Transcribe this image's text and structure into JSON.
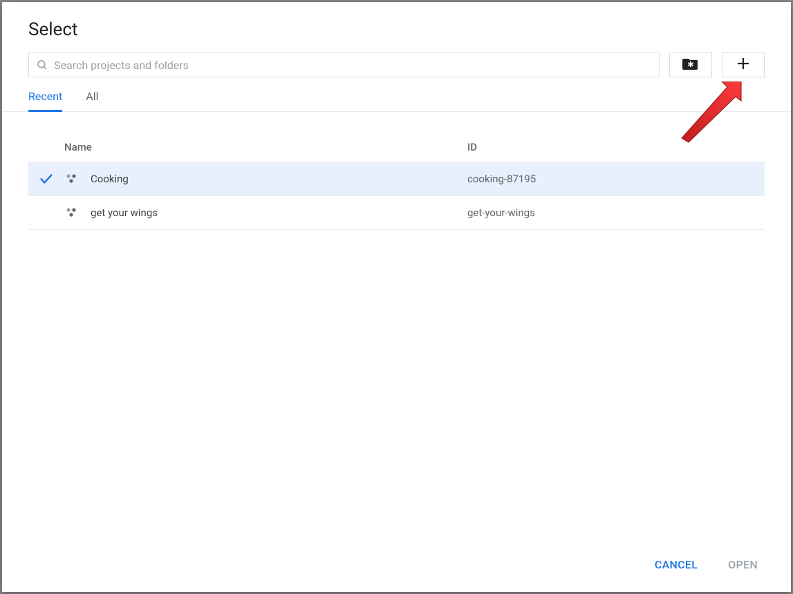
{
  "dialog": {
    "title": "Select"
  },
  "search": {
    "placeholder": "Search projects and folders",
    "value": ""
  },
  "tabs": [
    {
      "label": "Recent",
      "active": true
    },
    {
      "label": "All",
      "active": false
    }
  ],
  "columns": {
    "name": "Name",
    "id": "ID"
  },
  "rows": [
    {
      "selected": true,
      "name": "Cooking",
      "id": "cooking-87195"
    },
    {
      "selected": false,
      "name": "get your wings",
      "id": "get-your-wings"
    }
  ],
  "buttons": {
    "cancel": "CANCEL",
    "open": "OPEN"
  }
}
